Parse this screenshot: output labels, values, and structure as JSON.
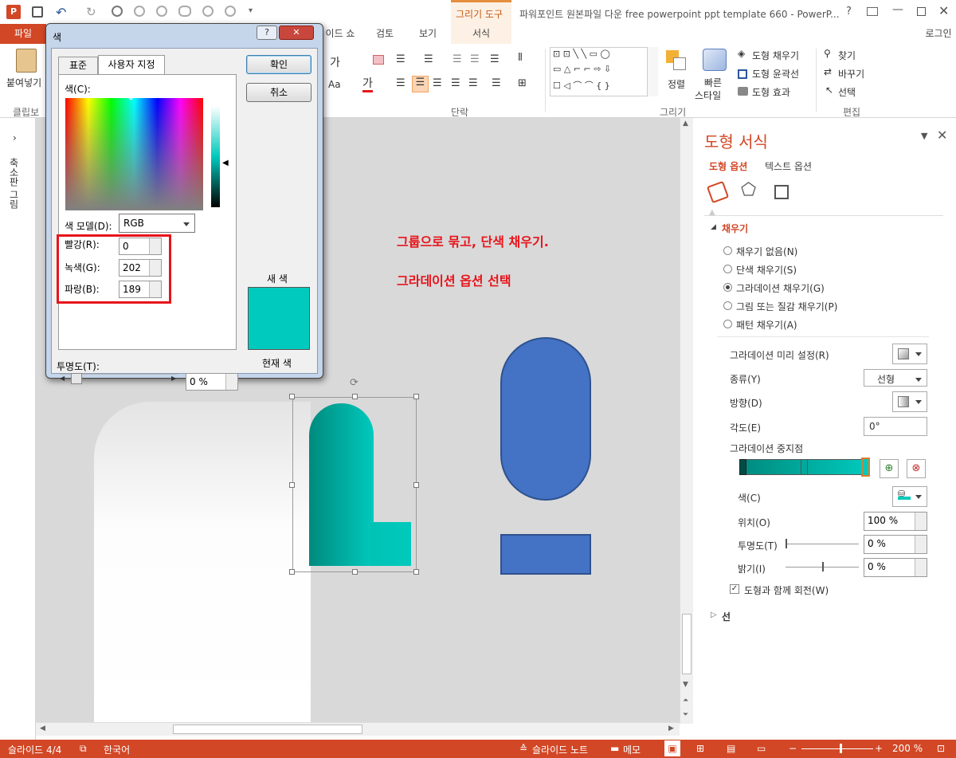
{
  "window": {
    "title": "파워포인트 원본파일 다운 free powerpoint ppt template 660 - PowerP...",
    "context_tab_group": "그리기 도구",
    "help": "?",
    "login": "로그인"
  },
  "tabs": [
    "파일",
    "이드 쇼",
    "검토",
    "보기",
    "서식"
  ],
  "ribbon": {
    "paste_label": "붙여넣기",
    "clipboard_group": "클립보",
    "paragraph_group": "단락",
    "drawing_group": "그리기",
    "editing_group": "편집",
    "arrange_label": "정렬",
    "quick_styles_label_1": "빠른",
    "quick_styles_label_2": "스타일",
    "shape_fill": "도형 채우기",
    "shape_outline": "도형 윤곽선",
    "shape_effects": "도형 효과",
    "find": "찾기",
    "replace": "바꾸기",
    "select": "선택",
    "font_big": "가",
    "font_aa": "Aa",
    "font_color_glyph": "가"
  },
  "left_strip": {
    "thumbnails_label": "축소판 그림"
  },
  "dialog": {
    "title": "색",
    "tab_standard": "표준",
    "tab_custom": "사용자 지정",
    "colors_label": "색(C):",
    "ok": "확인",
    "cancel": "취소",
    "color_model_label": "색 모델(D):",
    "color_model_value": "RGB",
    "red_label": "빨강(R):",
    "red_value": "0",
    "green_label": "녹색(G):",
    "green_value": "202",
    "blue_label": "파랑(B):",
    "blue_value": "189",
    "new_color_label": "새 색",
    "current_color_label": "현재 색",
    "transparency_label": "투명도(T):",
    "transparency_value": "0 %",
    "new_color": "#00cabd",
    "current_color": "#00cabd"
  },
  "annotations": {
    "line1": "그룹으로 묶고, 단색 채우기.",
    "line2": "그라데이션 옵션 선택",
    "color": "#e8141b"
  },
  "panel": {
    "title": "도형 서식",
    "tab_shape": "도형 옵션",
    "tab_text": "텍스트 옵션",
    "fill_section": "채우기",
    "fill_options": [
      "채우기 없음(N)",
      "단색 채우기(S)",
      "그라데이션 채우기(G)",
      "그림 또는 질감 채우기(P)",
      "패턴 채우기(A)"
    ],
    "fill_selected_index": 2,
    "preset_label": "그라데이션 미리 설정(R)",
    "type_label": "종류(Y)",
    "type_value": "선형",
    "direction_label": "방향(D)",
    "angle_label": "각도(E)",
    "angle_value": "0°",
    "stops_label": "그라데이션 중지점",
    "color_label": "색(C)",
    "position_label": "위치(O)",
    "position_value": "100 %",
    "transparency_label": "투명도(T)",
    "transparency_value": "0 %",
    "brightness_label": "밝기(I)",
    "brightness_value": "0 %",
    "rotate_label": "도형과 함께 회전(W)",
    "line_section": "선"
  },
  "status": {
    "slide": "슬라이드 4/4",
    "lang": "한국어",
    "notes": "슬라이드 노트",
    "comments": "메모",
    "zoom": "200 %"
  },
  "colors": {
    "accent": "#d24726",
    "shape_blue": "#4472c4",
    "teal_dark": "#008a7e",
    "teal": "#00cabd"
  }
}
